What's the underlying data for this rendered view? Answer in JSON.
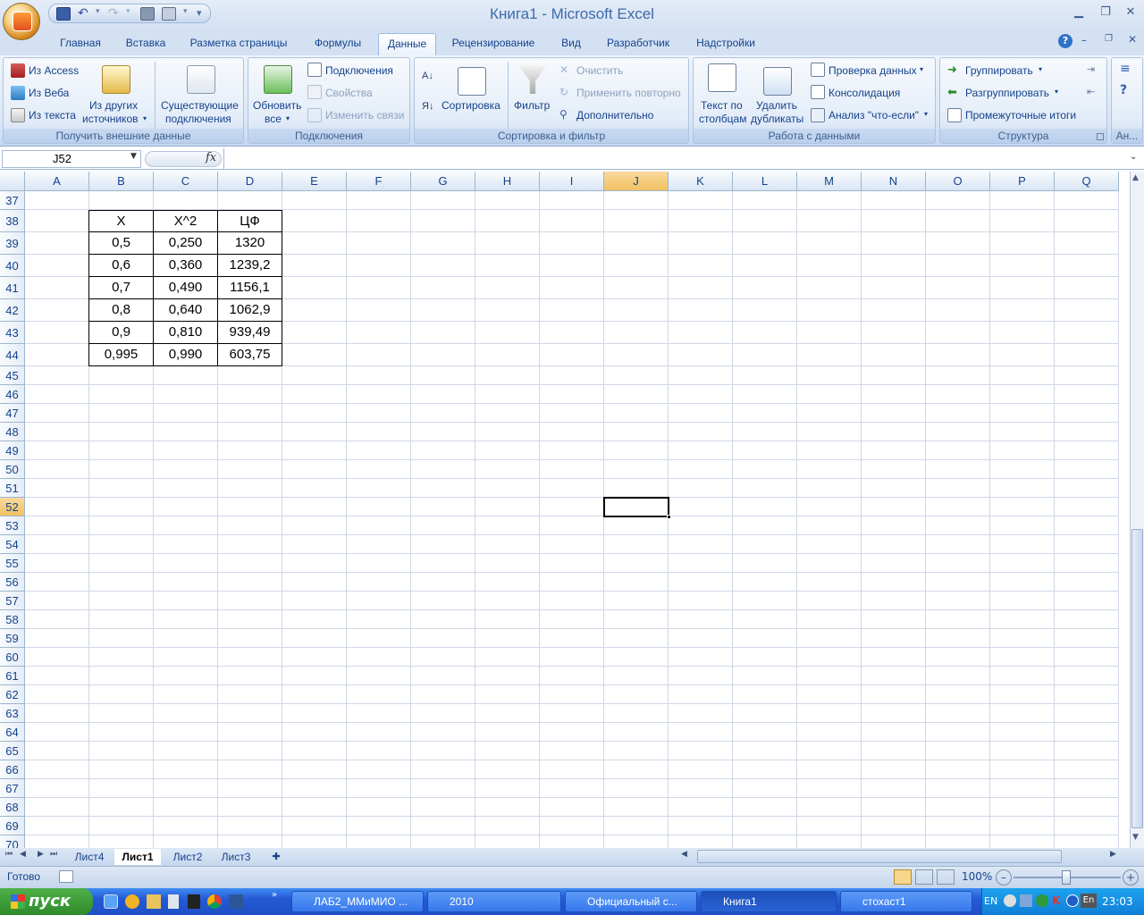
{
  "window": {
    "title": "Книга1 - Microsoft Excel"
  },
  "ribbon_tabs": [
    "Главная",
    "Вставка",
    "Разметка страницы",
    "Формулы",
    "Данные",
    "Рецензирование",
    "Вид",
    "Разработчик",
    "Надстройки"
  ],
  "active_tab": "Данные",
  "groups": {
    "external": {
      "label": "Получить внешние данные",
      "access": "Из Access",
      "web": "Из Веба",
      "text": "Из текста",
      "other1": "Из других",
      "other2": "источников",
      "existing1": "Существующие",
      "existing2": "подключения"
    },
    "connections": {
      "label": "Подключения",
      "refresh1": "Обновить",
      "refresh2": "все",
      "connections": "Подключения",
      "properties": "Свойства",
      "edit_links": "Изменить связи"
    },
    "sort": {
      "label": "Сортировка и фильтр",
      "sort": "Сортировка",
      "filter": "Фильтр",
      "clear": "Очистить",
      "reapply": "Применить повторно",
      "advanced": "Дополнительно"
    },
    "datatools": {
      "label": "Работа с данными",
      "text_cols1": "Текст по",
      "text_cols2": "столбцам",
      "remove_dup1": "Удалить",
      "remove_dup2": "дубликаты",
      "validation": "Проверка данных",
      "consolidate": "Консолидация",
      "whatif": "Анализ \"что-если\""
    },
    "outline": {
      "label": "Структура",
      "group": "Группировать",
      "ungroup": "Разгруппировать",
      "subtotal": "Промежуточные итоги"
    },
    "analysis": {
      "label": "Ан..."
    }
  },
  "formula_bar": {
    "name_box": "J52",
    "fx": "fx",
    "value": ""
  },
  "columns": [
    "A",
    "B",
    "C",
    "D",
    "E",
    "F",
    "G",
    "H",
    "I",
    "J",
    "K",
    "L",
    "M",
    "N",
    "O",
    "P",
    "Q"
  ],
  "selected_column": "J",
  "rows": [
    "37",
    "38",
    "39",
    "40",
    "41",
    "42",
    "43",
    "44",
    "45",
    "46",
    "47",
    "48",
    "49",
    "50",
    "51",
    "52",
    "53",
    "54",
    "55",
    "56",
    "57",
    "58",
    "59",
    "60",
    "61",
    "62",
    "63",
    "64",
    "65",
    "66",
    "67",
    "68",
    "69",
    "70"
  ],
  "selected_row": "52",
  "table": {
    "header": [
      "X",
      "X^2",
      "ЦФ"
    ],
    "data": [
      [
        "0,5",
        "0,250",
        "1320"
      ],
      [
        "0,6",
        "0,360",
        "1239,2"
      ],
      [
        "0,7",
        "0,490",
        "1156,1"
      ],
      [
        "0,8",
        "0,640",
        "1062,9"
      ],
      [
        "0,9",
        "0,810",
        "939,49"
      ],
      [
        "0,995",
        "0,990",
        "603,75"
      ]
    ]
  },
  "sheets": [
    "Лист4",
    "Лист1",
    "Лист2",
    "Лист3"
  ],
  "active_sheet": "Лист1",
  "status": {
    "ready": "Готово",
    "zoom": "100%"
  },
  "taskbar": {
    "start": "пуск",
    "tasks": [
      "ЛАБ2_ММиМИО ...",
      "2010",
      "Официальный с...",
      "Книга1",
      "стохаст1"
    ],
    "active_task": "Книга1",
    "lang": "EN",
    "lang2": "En",
    "clock": "23:03"
  }
}
